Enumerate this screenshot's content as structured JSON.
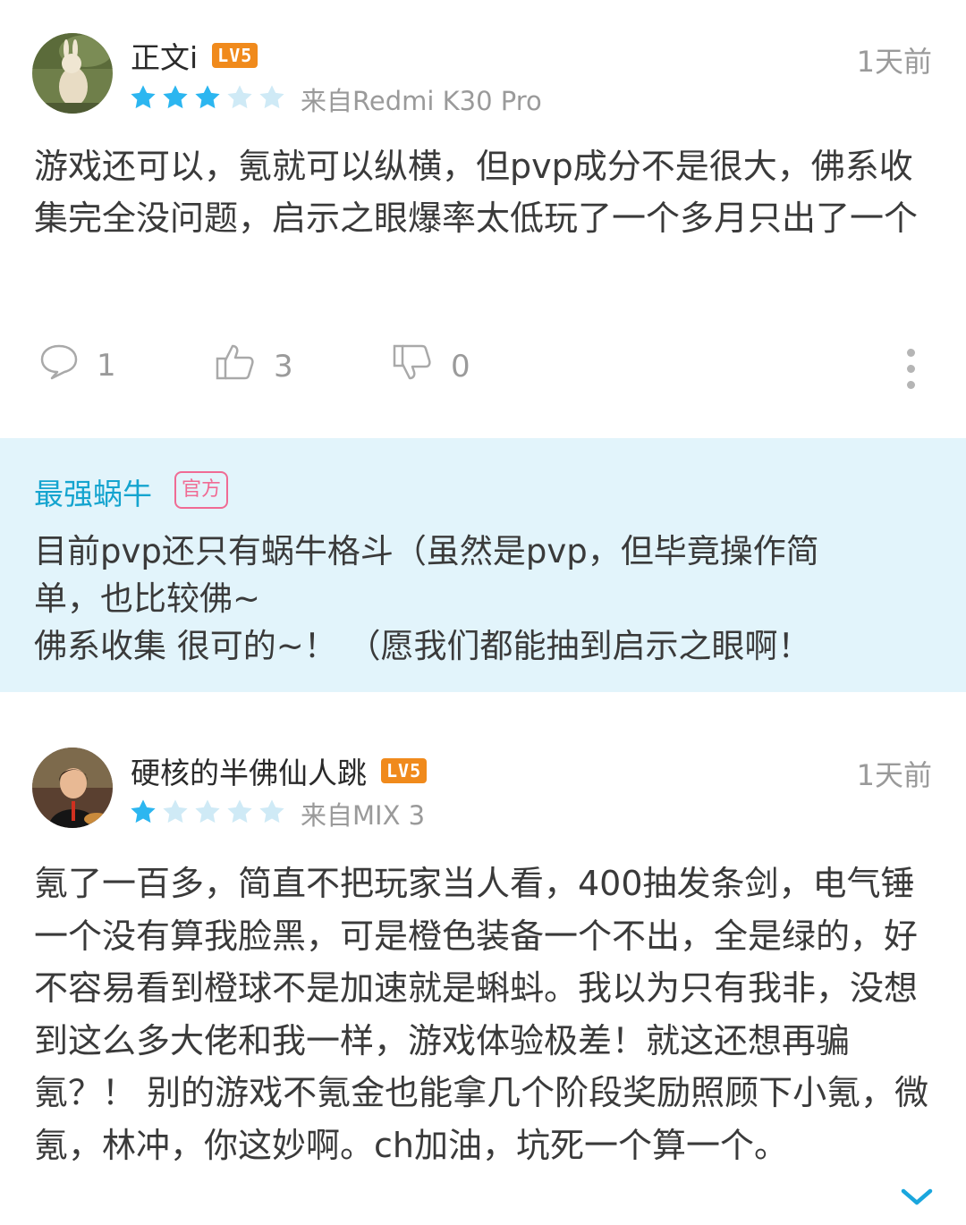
{
  "reviews": [
    {
      "username": "正文i",
      "level": "LV5",
      "time": "1天前",
      "rating": 3,
      "device": "来自Redmi K30 Pro",
      "text": "游戏还可以，氪就可以纵横，但pvp成分不是很大，佛系收集完全没问题，启示之眼爆率太低玩了一个多月只出了一个",
      "comments": "1",
      "likes": "3",
      "dislikes": "0"
    },
    {
      "username": "硬核的半佛仙人跳",
      "level": "LV5",
      "time": "1天前",
      "rating": 1,
      "device": "来自MIX 3",
      "text": "氪了一百多，简直不把玩家当人看，400抽发条剑，电气锤一个没有算我脸黑，可是橙色装备一个不出，全是绿的，好不容易看到橙球不是加速就是蝌蚪。我以为只有我非，没想到这么多大佬和我一样，游戏体验极差！就这还想再骗氪？！ 别的游戏不氪金也能拿几个阶段奖励照顾下小氪，微氪，林冲，你这妙啊。ch加油，坑死一个算一个。"
    }
  ],
  "official_reply": {
    "name": "最强蜗牛",
    "badge": "官方",
    "lines": [
      "目前pvp还只有蜗牛格斗（虽然是pvp，但毕竟操作简",
      "单，也比较佛~",
      "佛系收集 很可的~！ （愿我们都能抽到启示之眼啊！"
    ]
  },
  "colors": {
    "star_filled": "#2cb6f0",
    "star_empty": "#cfeaf6",
    "level_badge": "#f08a1c",
    "official_bg": "#e2f4fb",
    "official_name": "#14a4cf",
    "official_badge": "#f06b94"
  },
  "icons": [
    "comment-icon",
    "thumbs-up-icon",
    "thumbs-down-icon",
    "more-icon",
    "star-icon",
    "chevron-down-icon"
  ]
}
